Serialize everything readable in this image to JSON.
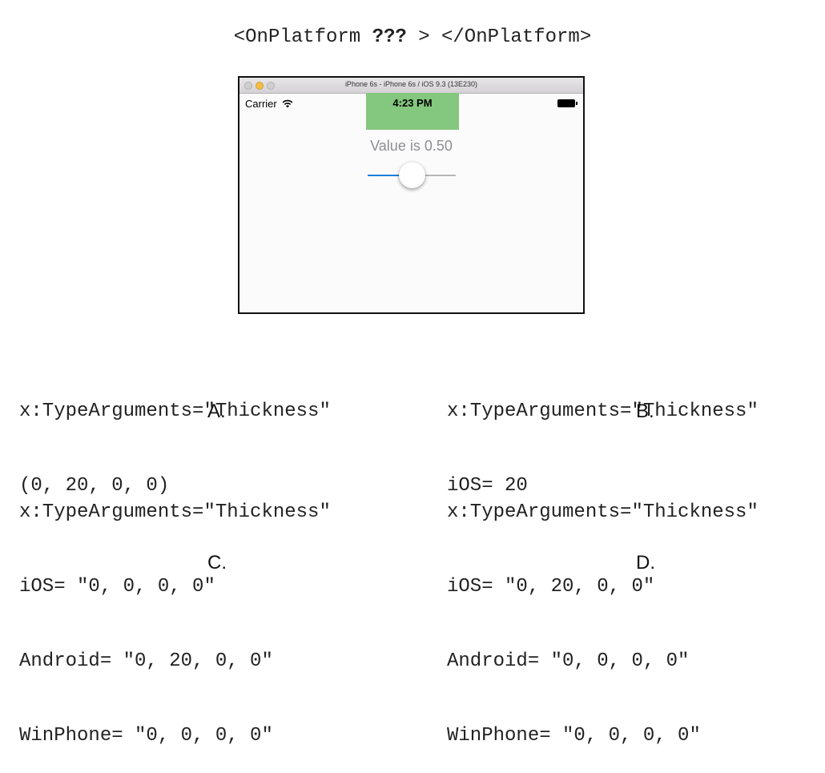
{
  "question": {
    "prefix": "<OnPlatform ",
    "placeholder": "???",
    "suffix": " > </OnPlatform>"
  },
  "simulator": {
    "title": "iPhone 6s - iPhone 6s / iOS 9.3 (13E230)",
    "carrier": "Carrier",
    "time": "4:23 PM",
    "value_label": "Value is 0.50",
    "slider_value": 0.5,
    "accent_color": "#84c77e"
  },
  "options": [
    {
      "letter": "A.",
      "lines": [
        "x:TypeArguments=\"Thickness\"",
        "(0, 20, 0, 0)"
      ]
    },
    {
      "letter": "B.",
      "lines": [
        "x:TypeArguments=\"Thickness\"",
        "iOS= 20"
      ]
    },
    {
      "letter": "C.",
      "lines": [
        "x:TypeArguments=\"Thickness\"",
        "iOS= \"0, 0, 0, 0\"",
        "Android= \"0, 20, 0, 0\"",
        "WinPhone= \"0, 0, 0, 0\""
      ]
    },
    {
      "letter": "D.",
      "lines": [
        "x:TypeArguments=\"Thickness\"",
        "iOS= \"0, 20, 0, 0\"",
        "Android= \"0, 0, 0, 0\"",
        "WinPhone= \"0, 0, 0, 0\""
      ]
    }
  ]
}
